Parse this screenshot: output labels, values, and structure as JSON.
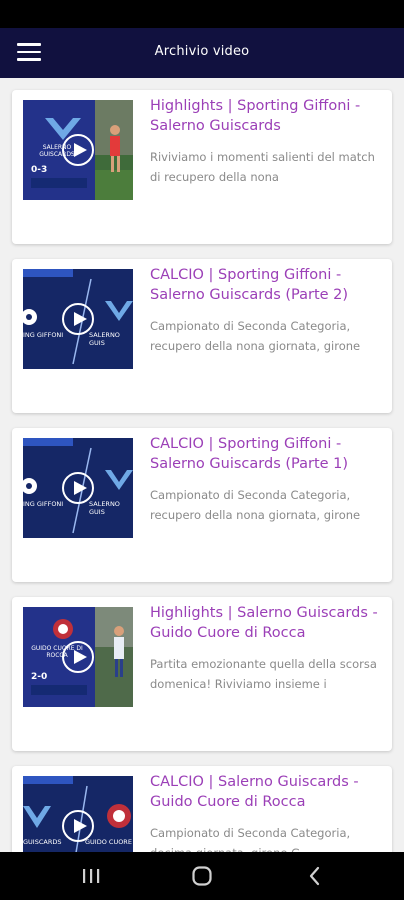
{
  "app_bar": {
    "title": "Archivio video",
    "menu_icon": "hamburger-menu-icon"
  },
  "colors": {
    "app_bar_bg": "#11113f",
    "title_accent": "#9b3fb7",
    "description_gray": "#8a8a8a"
  },
  "videos": [
    {
      "title": "Highlights | Sporting Giffoni - Salerno Guiscards",
      "description": "Riviviamo i momenti salienti del match di recupero della nona",
      "thumb_score": "0-3",
      "thumb_caption": "SALERNO GUISCARDS"
    },
    {
      "title": "CALCIO | Sporting Giffoni - Salerno Guiscards (Parte 2)",
      "description": "Campionato di Seconda Categoria, recupero della nona giornata, girone",
      "thumb_left": "ING GIFFONI",
      "thumb_right": "SALERNO GUIS"
    },
    {
      "title": "CALCIO | Sporting Giffoni - Salerno Guiscards (Parte 1)",
      "description": "Campionato di Seconda Categoria, recupero della nona giornata, girone",
      "thumb_left": "ING GIFFONI",
      "thumb_right": "SALERNO GUIS"
    },
    {
      "title": "Highlights | Salerno Guiscards - Guido Cuore di Rocca",
      "description": "Partita emozionante quella della scorsa domenica! Riviviamo insieme i",
      "thumb_score": "2-0",
      "thumb_caption": "GUIDO CUORE DI ROCCA"
    },
    {
      "title": "CALCIO | Salerno Guiscards - Guido Cuore di Rocca",
      "description": "Campionato di Seconda Categoria, decima giornata, girone G.",
      "thumb_left": "GUISCARDS",
      "thumb_right": "GUIDO CUORE"
    }
  ],
  "nav": {
    "recents_icon": "recent-apps-icon",
    "home_icon": "home-icon",
    "back_icon": "back-icon"
  }
}
